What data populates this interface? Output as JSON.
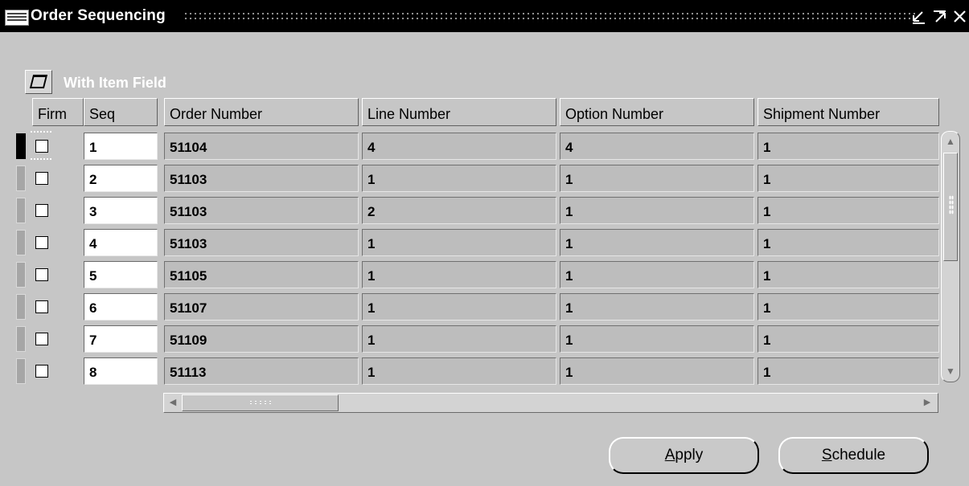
{
  "window": {
    "title": "Order Sequencing",
    "icons": [
      "oracle-icon",
      "minimize-icon",
      "maximize-icon",
      "close-icon"
    ]
  },
  "folder": {
    "title": "With Item Field",
    "icon": "folder-open-icon"
  },
  "columns": {
    "firm": "Firm",
    "seq": "Seq",
    "order_number": "Order Number",
    "line_number": "Line Number",
    "option_number": "Option Number",
    "shipment_number": "Shipment Number"
  },
  "rows": [
    {
      "seq": "1",
      "order_number": "51104",
      "line_number": "4",
      "option_number": "4",
      "shipment_number": "1",
      "firm": false
    },
    {
      "seq": "2",
      "order_number": "51103",
      "line_number": "1",
      "option_number": "1",
      "shipment_number": "1",
      "firm": false
    },
    {
      "seq": "3",
      "order_number": "51103",
      "line_number": "2",
      "option_number": "1",
      "shipment_number": "1",
      "firm": false
    },
    {
      "seq": "4",
      "order_number": "51103",
      "line_number": "1",
      "option_number": "1",
      "shipment_number": "1",
      "firm": false
    },
    {
      "seq": "5",
      "order_number": "51105",
      "line_number": "1",
      "option_number": "1",
      "shipment_number": "1",
      "firm": false
    },
    {
      "seq": "6",
      "order_number": "51107",
      "line_number": "1",
      "option_number": "1",
      "shipment_number": "1",
      "firm": false
    },
    {
      "seq": "7",
      "order_number": "51109",
      "line_number": "1",
      "option_number": "1",
      "shipment_number": "1",
      "firm": false
    },
    {
      "seq": "8",
      "order_number": "51113",
      "line_number": "1",
      "option_number": "1",
      "shipment_number": "1",
      "firm": false
    }
  ],
  "buttons": {
    "apply": {
      "label": "Apply",
      "mnemonic": "A"
    },
    "schedule": {
      "label": "Schedule",
      "mnemonic": "S"
    }
  },
  "colors": {
    "titlebar": "#000000",
    "background": "#c6c6c6",
    "cell": "#bdbdbd",
    "input": "#ffffff"
  }
}
